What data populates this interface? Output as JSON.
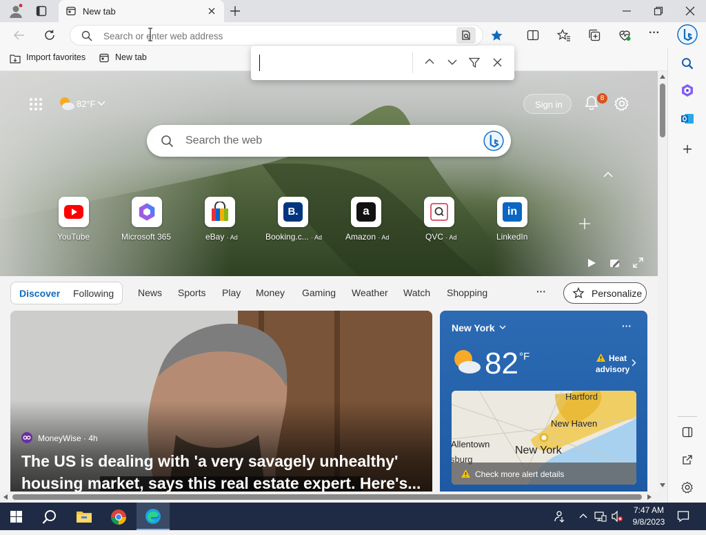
{
  "browser": {
    "tab_title": "New tab",
    "address_placeholder": "Search or enter web address",
    "favorites_bar": [
      {
        "label": "Import favorites"
      },
      {
        "label": "New tab"
      }
    ],
    "find_bar": {
      "value": ""
    }
  },
  "newtab": {
    "weather_chip": "82°F",
    "sign_in": "Sign in",
    "notification_count": "8",
    "search_placeholder": "Search the web",
    "quick_links": [
      {
        "label": "YouTube",
        "ad": "",
        "icon": "youtube-icon"
      },
      {
        "label": "Microsoft 365",
        "ad": "",
        "icon": "microsoft-365-icon"
      },
      {
        "label": "eBay",
        "ad": "· Ad",
        "icon": "ebay-icon"
      },
      {
        "label": "Booking.c...",
        "ad": "· Ad",
        "icon": "booking-icon"
      },
      {
        "label": "Amazon",
        "ad": "· Ad",
        "icon": "amazon-icon"
      },
      {
        "label": "QVC",
        "ad": "· Ad",
        "icon": "qvc-icon"
      },
      {
        "label": "LinkedIn",
        "ad": "",
        "icon": "linkedin-icon"
      }
    ],
    "feed_tabs": {
      "discover": "Discover",
      "following": "Following",
      "items": [
        "News",
        "Sports",
        "Play",
        "Money",
        "Gaming",
        "Weather",
        "Watch",
        "Shopping"
      ],
      "more": "···",
      "personalize": "Personalize"
    },
    "article": {
      "source": "MoneyWise · 4h",
      "headline": "The US is dealing with 'a very savagely unhealthy' housing market, says this real estate expert. Here's..."
    },
    "weather_card": {
      "location": "New York",
      "temperature": "82",
      "unit": "°F",
      "alert_line1": "Heat",
      "alert_line2": "advisory",
      "map_labels": [
        "Hartford",
        "New Haven",
        "Allentown",
        "New York",
        "sburg"
      ],
      "alert_link": "Check more alert details",
      "more": "···"
    }
  },
  "taskbar": {
    "time": "7:47 AM",
    "date": "9/8/2023"
  },
  "colors": {
    "accent": "#0f6cbd",
    "weather_bg": "#2c6bb3",
    "taskbar": "#1f2b44"
  }
}
